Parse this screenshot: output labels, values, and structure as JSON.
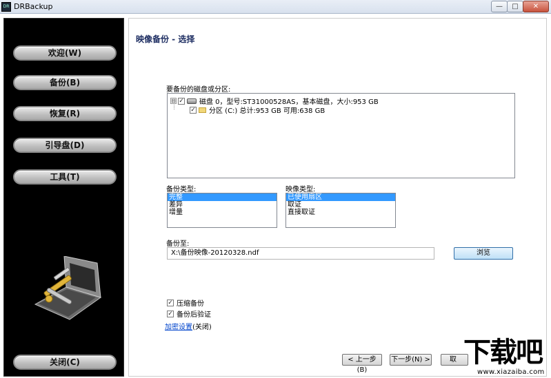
{
  "window": {
    "title": "DRBackup",
    "icon_text": "DR",
    "min_glyph": "—",
    "max_glyph": "□",
    "close_glyph": "✕"
  },
  "sidebar": {
    "items": [
      {
        "label": "欢迎(W)"
      },
      {
        "label": "备份(B)"
      },
      {
        "label": "恢复(R)"
      },
      {
        "label": "引导盘(D)"
      },
      {
        "label": "工具(T)"
      }
    ],
    "close_label": "关闭(C)"
  },
  "main": {
    "title": "映像备份 - 选择",
    "disk_section_label": "要备份的磁盘或分区:",
    "tree": {
      "disk": {
        "expander": "⊟",
        "checked": "✓",
        "label": "磁盘 0，型号:ST31000528AS，基本磁盘，大小:953 GB"
      },
      "partition": {
        "checked": "✓",
        "label": "分区 (C:) 总计:953 GB   可用:638 GB"
      }
    },
    "backup_type": {
      "label": "备份类型:",
      "options": [
        "完整",
        "差异",
        "增量"
      ],
      "selected": "完整"
    },
    "image_type": {
      "label": "映像类型:",
      "options": [
        "已使用扇区",
        "取证",
        "直接取证"
      ],
      "selected": "已使用扇区"
    },
    "backup_to": {
      "label": "备份至:",
      "value": "X:\\备份映像-20120328.ndf"
    },
    "browse_label": "浏览",
    "compress": {
      "label": "压缩备份",
      "checked": "✓"
    },
    "verify": {
      "label": "备份后验证",
      "checked": "✓"
    },
    "encrypt_link": "加密设置",
    "encrypt_state": "(关闭)",
    "prev_label": "< 上一步(B)",
    "next_label": "下一步(N) >",
    "cancel_label": "取"
  },
  "watermark": {
    "text": "下载吧",
    "url": "www.xiazaiba.com"
  },
  "colors": {
    "selection": "#3399ff",
    "title": "#1f2f63",
    "sidebar_bg": "#000000",
    "link": "#0044cc"
  }
}
